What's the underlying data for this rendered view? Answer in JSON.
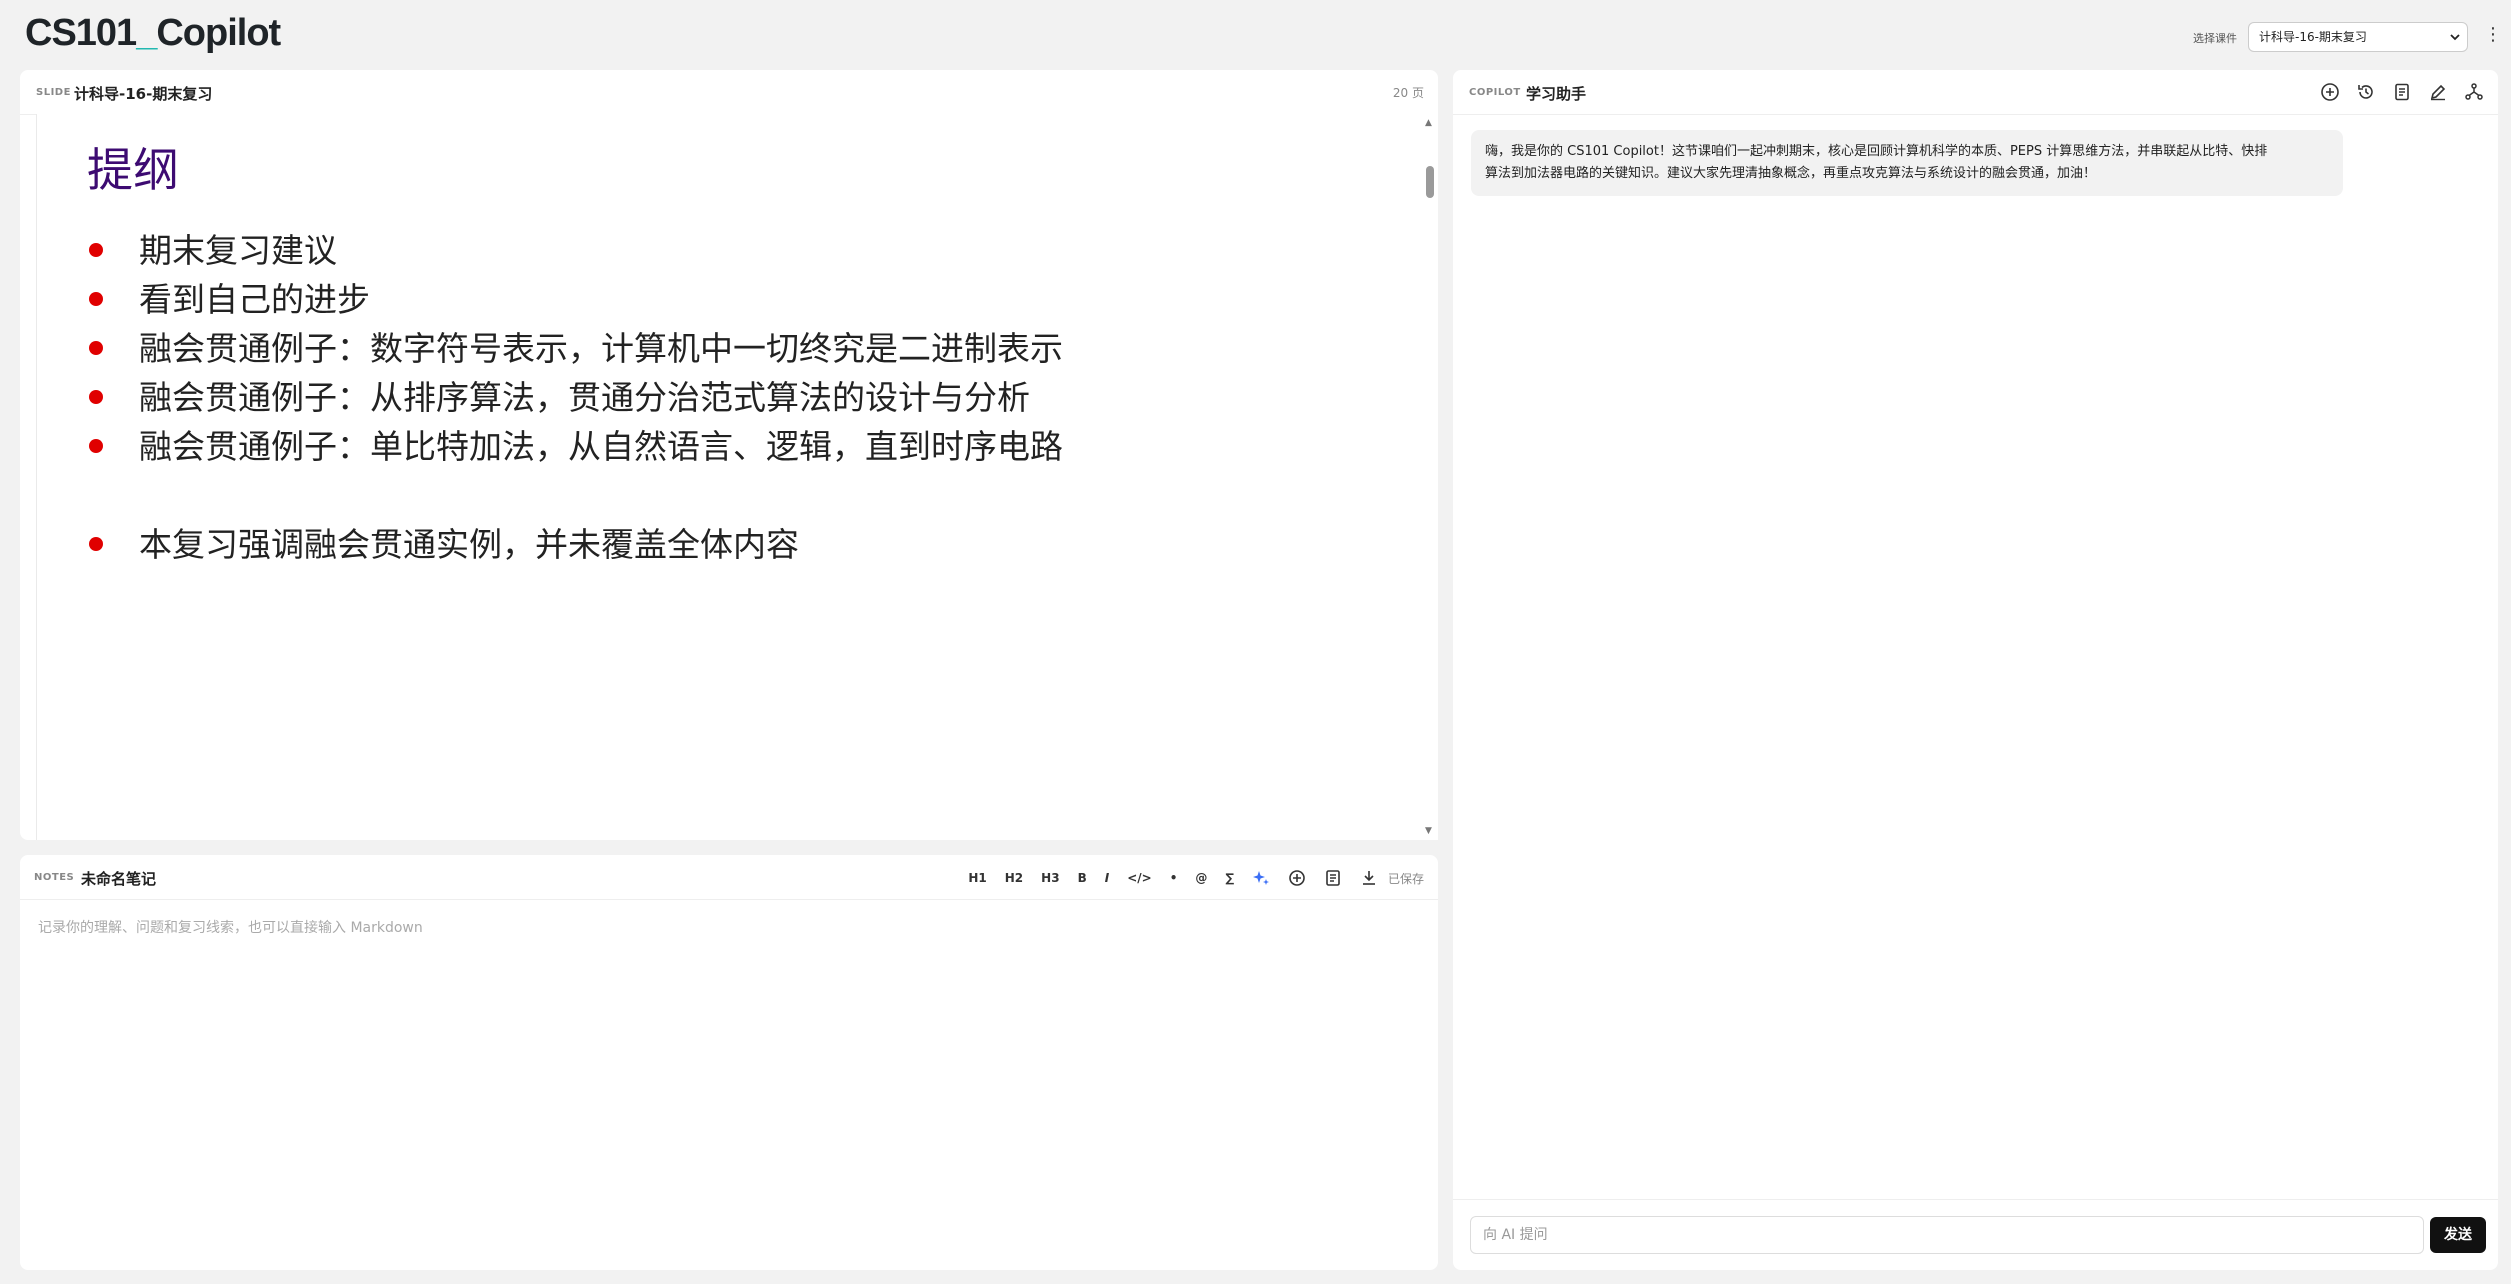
{
  "app": {
    "title_main": "CS101",
    "title_cursor": "_",
    "title_rest": "Copilot"
  },
  "course": {
    "label": "选择课件",
    "selected": "计科导-16-期末复习"
  },
  "slide": {
    "tag": "SLIDE",
    "title": "计科导-16-期末复习",
    "page_count": "20 页",
    "heading": "提纲",
    "bullets": [
      "期末复习建议",
      "看到自己的进步",
      "融会贯通例子：数字符号表示，计算机中一切终究是二进制表示",
      "融会贯通例子：从排序算法，贯通分治范式算法的设计与分析",
      "融会贯通例子：单比特加法，从自然语言、逻辑，直到时序电路",
      "本复习强调融会贯通实例，并未覆盖全体内容"
    ]
  },
  "notes": {
    "tag": "NOTES",
    "title": "未命名笔记",
    "toolbar": {
      "h1": "H1",
      "h2": "H2",
      "h3": "H3",
      "bold": "B",
      "italic": "I",
      "code": "</>",
      "bullet": "•",
      "mention": "@",
      "sum": "∑",
      "saved": "已保存"
    },
    "placeholder": "记录你的理解、问题和复习线索，也可以直接输入 Markdown"
  },
  "copilot": {
    "tag": "COPILOT",
    "title": "学习助手",
    "message_line1": "嗨，我是你的 CS101 Copilot！这节课咱们一起冲刺期末，核心是回顾计算机科学的本质、PEPS 计算思维方法，并串联起从比特、快排",
    "message_line2": "算法到加法器电路的关键知识。建议大家先理清抽象概念，再重点攻克算法与系统设计的融会贯通，加油！",
    "input_placeholder": "向 AI 提问",
    "send_label": "发送"
  },
  "colors": {
    "accent": "#22b8b0",
    "heading": "#3d0b72",
    "bullet": "#e00000",
    "send_bg": "#111111",
    "ai_icon": "#3b6ef5"
  }
}
